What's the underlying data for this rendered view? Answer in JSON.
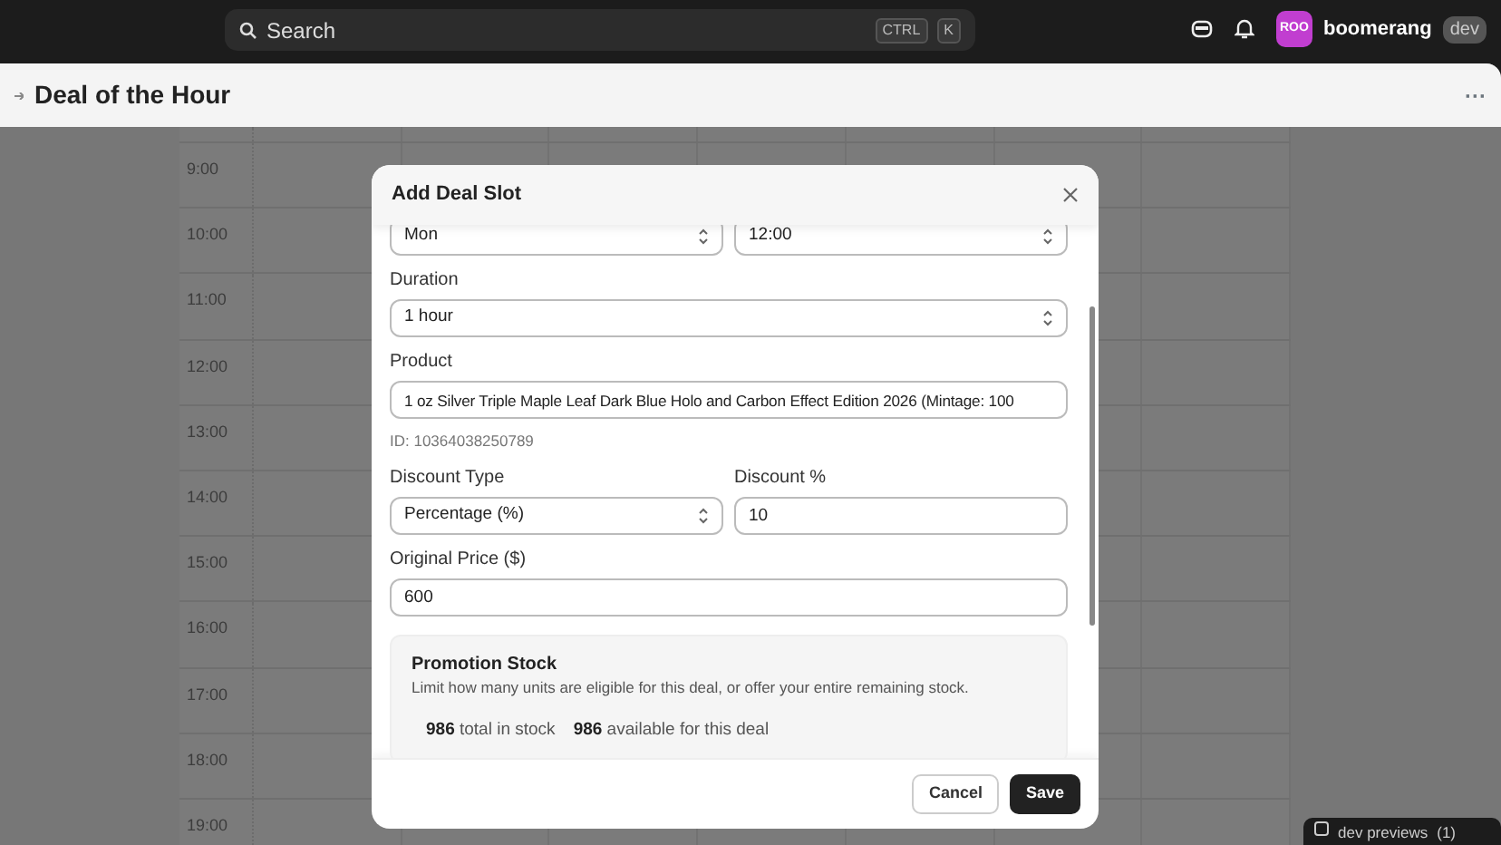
{
  "top_bar": {
    "search": {
      "placeholder": "Search",
      "shortcut": [
        "CTRL",
        "K"
      ]
    },
    "account": {
      "avatar_text": "ROO",
      "name": "boomerang",
      "badge": "dev"
    }
  },
  "page": {
    "title": "Deal of the Hour",
    "more": "···"
  },
  "calendar": {
    "times": [
      "9:00",
      "10:00",
      "11:00",
      "12:00",
      "13:00",
      "14:00",
      "15:00",
      "16:00",
      "17:00",
      "18:00",
      "19:00"
    ]
  },
  "dialog": {
    "title": "Add Deal Slot",
    "fields": [
      {
        "kind": "pair",
        "items": [
          {
            "kind": "select",
            "value": "Mon"
          },
          {
            "kind": "select",
            "value": "12:00"
          }
        ]
      },
      {
        "kind": "single",
        "label": "Duration",
        "control": {
          "kind": "select",
          "value": "1 hour"
        }
      },
      {
        "kind": "single",
        "label": "Product",
        "control": {
          "kind": "input",
          "value": "1 oz Silver Triple Maple Leaf Dark Blue Holo and Carbon Effect Edition 2026 (Mintage: 100"
        },
        "hint": "ID: 10364038250789"
      },
      {
        "kind": "pair",
        "items": [
          {
            "kind": "select",
            "label": "Discount Type",
            "value": "Percentage (%)"
          },
          {
            "kind": "input",
            "label": "Discount %",
            "value": "10"
          }
        ]
      },
      {
        "kind": "single",
        "label": "Original Price ($)",
        "control": {
          "kind": "input",
          "value": "600"
        }
      }
    ],
    "stock": {
      "title": "Promotion Stock",
      "description": "Limit how many units are eligible for this deal, or offer your entire remaining stock.",
      "stats": [
        "**986** total in stock",
        "**986** available for this deal"
      ]
    },
    "buttons": [
      {
        "label": "Cancel",
        "kind": "secondary"
      },
      {
        "label": "Save",
        "kind": "primary"
      }
    ]
  },
  "toast": {
    "label": "dev previews",
    "count": "(1)"
  }
}
